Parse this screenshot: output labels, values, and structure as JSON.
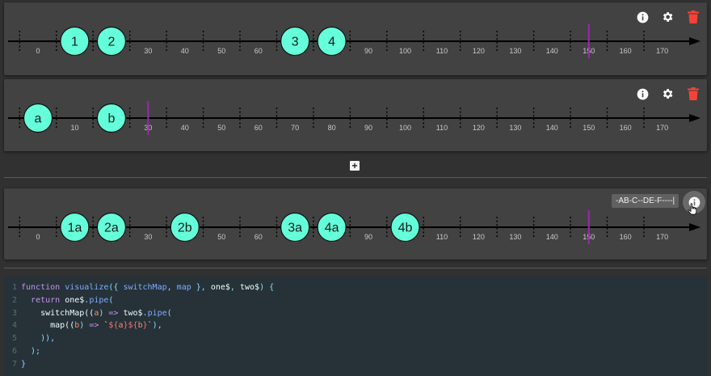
{
  "ticks": [
    0,
    10,
    20,
    30,
    40,
    50,
    60,
    70,
    80,
    90,
    100,
    110,
    120,
    130,
    140,
    150,
    160,
    170
  ],
  "timelines": [
    {
      "id": "one",
      "marbles": [
        {
          "label": "1",
          "t": 10
        },
        {
          "label": "2",
          "t": 20
        },
        {
          "label": "3",
          "t": 70
        },
        {
          "label": "4",
          "t": 80
        }
      ],
      "completion": 150,
      "hidden_tick_labels": [
        10,
        20,
        70,
        80
      ],
      "icons": [
        "info-icon",
        "gear-icon",
        "delete-icon"
      ]
    },
    {
      "id": "two",
      "marbles": [
        {
          "label": "a",
          "t": 0
        },
        {
          "label": "b",
          "t": 20
        }
      ],
      "completion": 30,
      "hidden_tick_labels": [
        0,
        20
      ],
      "icons": [
        "info-icon",
        "gear-icon",
        "delete-icon"
      ]
    },
    {
      "id": "result",
      "marbles": [
        {
          "label": "1a",
          "t": 10
        },
        {
          "label": "2a",
          "t": 20
        },
        {
          "label": "2b",
          "t": 40
        },
        {
          "label": "3a",
          "t": 70
        },
        {
          "label": "4a",
          "t": 80
        },
        {
          "label": "4b",
          "t": 100
        }
      ],
      "completion": 150,
      "hidden_tick_labels": [
        10,
        20,
        40,
        70,
        80,
        100
      ],
      "icons": [
        "info-icon"
      ]
    }
  ],
  "result_tooltip": "-AB-C--DE-F----|",
  "add_button_label": "+",
  "colors": {
    "marble_fill": "#64ffda",
    "completion_marker": "#9c27b0",
    "delete_icon": "#f44336",
    "panel_bg": "#424242",
    "page_bg": "#313131",
    "code_bg": "#263238"
  },
  "code": {
    "lines": [
      [
        {
          "t": "function ",
          "c": "kw"
        },
        {
          "t": "visualize",
          "c": "fn"
        },
        {
          "t": "({ ",
          "c": "pun"
        },
        {
          "t": "switchMap",
          "c": "fn"
        },
        {
          "t": ", ",
          "c": "pun"
        },
        {
          "t": "map",
          "c": "fn"
        },
        {
          "t": " }, ",
          "c": "pun"
        },
        {
          "t": "one$",
          "c": ""
        },
        {
          "t": ", ",
          "c": "pun"
        },
        {
          "t": "two$",
          "c": ""
        },
        {
          "t": ") {",
          "c": "pun"
        }
      ],
      [
        {
          "t": "  ",
          "c": ""
        },
        {
          "t": "return ",
          "c": "kw"
        },
        {
          "t": "one$",
          "c": ""
        },
        {
          "t": ".",
          "c": "pun"
        },
        {
          "t": "pipe",
          "c": "fn"
        },
        {
          "t": "(",
          "c": "pun"
        }
      ],
      [
        {
          "t": "    switchMap((",
          "c": ""
        },
        {
          "t": "a",
          "c": "prm"
        },
        {
          "t": ") ",
          "c": "pun"
        },
        {
          "t": "=>",
          "c": "kw"
        },
        {
          "t": " two$",
          "c": ""
        },
        {
          "t": ".",
          "c": "pun"
        },
        {
          "t": "pipe",
          "c": "fn"
        },
        {
          "t": "(",
          "c": "pun"
        }
      ],
      [
        {
          "t": "      map((",
          "c": ""
        },
        {
          "t": "b",
          "c": "prm"
        },
        {
          "t": ") ",
          "c": "pun"
        },
        {
          "t": "=>",
          "c": "kw"
        },
        {
          "t": " ",
          "c": ""
        },
        {
          "t": "`",
          "c": "str"
        },
        {
          "t": "${",
          "c": "tpl"
        },
        {
          "t": "a",
          "c": "prm"
        },
        {
          "t": "}",
          "c": "tpl"
        },
        {
          "t": "${",
          "c": "tpl"
        },
        {
          "t": "b",
          "c": "prm"
        },
        {
          "t": "}",
          "c": "tpl"
        },
        {
          "t": "`",
          "c": "str"
        },
        {
          "t": "),",
          "c": "pun"
        }
      ],
      [
        {
          "t": "    )),",
          "c": "pun"
        }
      ],
      [
        {
          "t": "  );",
          "c": "pun"
        }
      ],
      [
        {
          "t": "}",
          "c": "pun"
        }
      ]
    ]
  }
}
